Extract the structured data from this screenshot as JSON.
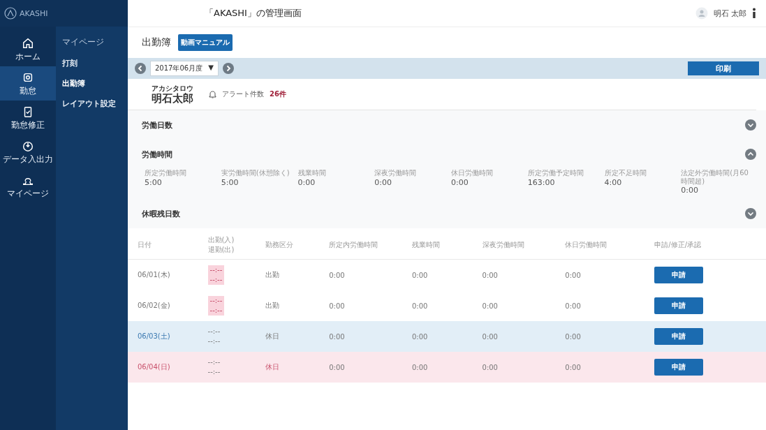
{
  "caption": "「AKASHI」の管理画面",
  "logo": {
    "text": "AKASHI"
  },
  "rail": [
    {
      "label": "ホーム",
      "selected": false
    },
    {
      "label": "勤怠",
      "selected": true
    },
    {
      "label": "勤怠修正",
      "selected": false
    },
    {
      "label": "データ入出力",
      "selected": false
    },
    {
      "label": "マイページ",
      "selected": false
    }
  ],
  "submenu": {
    "heading": "マイページ",
    "items": [
      {
        "label": "打刻",
        "selected": false
      },
      {
        "label": "出勤簿",
        "selected": true
      },
      {
        "label": "レイアウト設定",
        "selected": false
      }
    ]
  },
  "user": {
    "name": "明石 太郎"
  },
  "page_title": "出勤簿",
  "manual_button": "動画マニュアル",
  "month": {
    "value": "2017年06月度",
    "caret": "▼"
  },
  "print_button": "印刷",
  "employee": {
    "furigana": "アカシタロウ",
    "name": "明石太郎",
    "alert_label": "アラート件数",
    "alert_count": "26件"
  },
  "sections": [
    {
      "title": "労働日数",
      "expanded": false
    },
    {
      "title": "労働時間",
      "expanded": true,
      "stats": [
        {
          "label": "所定労働時間",
          "value": "5:00"
        },
        {
          "label": "実労働時間(休憩除く)",
          "value": "5:00"
        },
        {
          "label": "残業時間",
          "value": "0:00"
        },
        {
          "label": "深夜労働時間",
          "value": "0:00"
        },
        {
          "label": "休日労働時間",
          "value": "0:00"
        },
        {
          "label": "所定労働予定時間",
          "value": "163:00"
        },
        {
          "label": "所定不足時間",
          "value": "4:00"
        },
        {
          "label": "法定外労働時間(月60時間超)",
          "value": "0:00"
        }
      ]
    },
    {
      "title": "休暇残日数",
      "expanded": false
    }
  ],
  "table": {
    "columns": [
      "日付",
      "出勤(入)\n退勤(出)",
      "勤務区分",
      "所定内労働時間",
      "残業時間",
      "深夜労働時間",
      "休日労働時間",
      "申請/修正/承認"
    ],
    "rows": [
      {
        "cells": [
          "06/01(木)",
          "--:--\n--:--",
          "出勤",
          "0:00",
          "0:00",
          "0:00",
          "0:00"
        ],
        "action": "申請",
        "missing": true,
        "kind": "weekday"
      },
      {
        "cells": [
          "06/02(金)",
          "--:--\n--:--",
          "出勤",
          "0:00",
          "0:00",
          "0:00",
          "0:00"
        ],
        "action": "申請",
        "missing": true,
        "kind": "weekday"
      },
      {
        "cells": [
          "06/03(土)",
          "--:--\n--:--",
          "休日",
          "0:00",
          "0:00",
          "0:00",
          "0:00"
        ],
        "action": "申請",
        "missing": false,
        "kind": "saturday"
      },
      {
        "cells": [
          "06/04(日)",
          "--:--\n--:--",
          "休日",
          "0:00",
          "0:00",
          "0:00",
          "0:00"
        ],
        "action": "申請",
        "missing": false,
        "kind": "sunday"
      }
    ]
  }
}
